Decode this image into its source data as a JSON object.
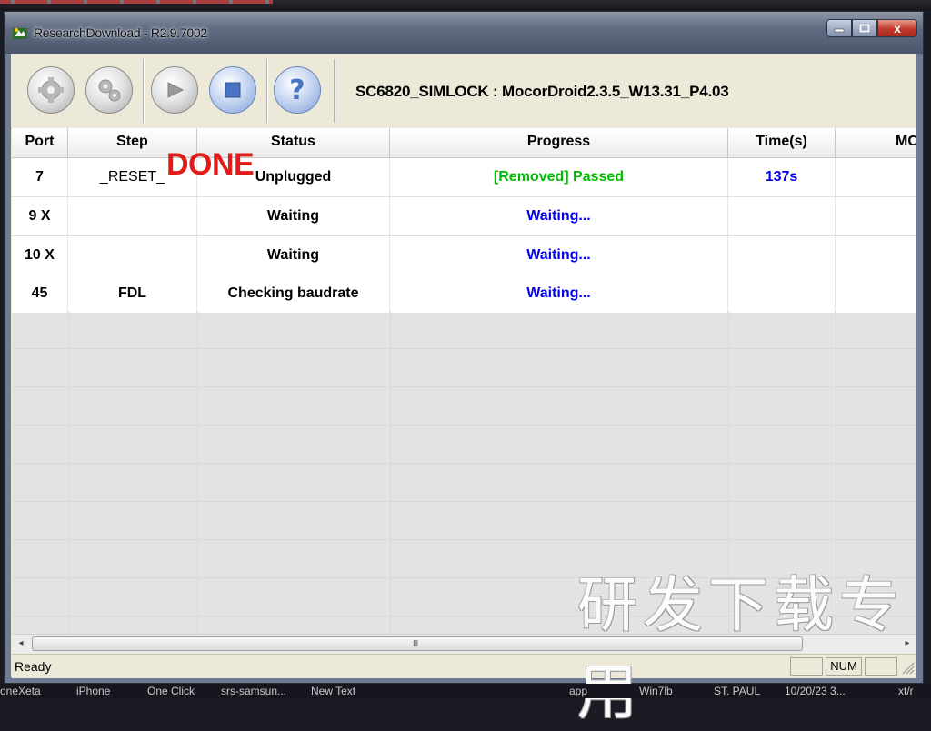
{
  "window": {
    "title": "ResearchDownload - R2.9.7002",
    "close_glyph": "x"
  },
  "toolbar": {
    "buttons": [
      {
        "icon": "gear-icon"
      },
      {
        "icon": "gears-icon"
      },
      {
        "icon": "play-icon"
      },
      {
        "icon": "stop-icon"
      },
      {
        "icon": "help-icon",
        "glyph": "?"
      }
    ],
    "product_text": "SC6820_SIMLOCK : MocorDroid2.3.5_W13.31_P4.03"
  },
  "table": {
    "columns": [
      "Port",
      "Step",
      "Status",
      "Progress",
      "Time(s)",
      "MC"
    ],
    "rows": [
      {
        "port": "7",
        "step": "_RESET_",
        "status": "Unplugged",
        "progress": "[Removed] Passed",
        "time": "137s"
      },
      {
        "port": "9 X",
        "step": "",
        "status": "Waiting",
        "progress": "Waiting...",
        "time": ""
      },
      {
        "port": "10 X",
        "step": "",
        "status": "Waiting",
        "progress": "Waiting...",
        "time": ""
      },
      {
        "port": "45",
        "step": "FDL",
        "status": "Checking baudrate",
        "progress": "Waiting...",
        "time": ""
      }
    ]
  },
  "overlay_text": "DONE",
  "watermark": "研发下载专用",
  "scrollbar": {
    "left": "◂",
    "right": "▸",
    "grip": "III"
  },
  "statusbar": {
    "text": "Ready",
    "num": "NUM"
  },
  "taskbar": [
    "oneXeta",
    "iPhone",
    "One Click",
    "srs-samsun...",
    "New Text",
    "app",
    "Win7lb",
    "ST. PAUL",
    "10/20/23 3...",
    "xt/r"
  ],
  "colors": {
    "passed": "#00bb00",
    "waiting": "#0000ee",
    "done_overlay": "#e11a1a",
    "close_button": "#c0392b"
  }
}
